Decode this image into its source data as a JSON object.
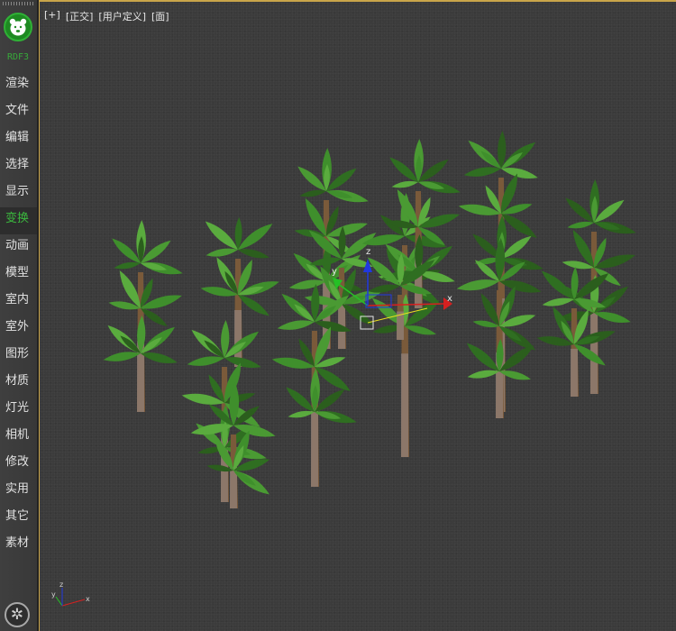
{
  "app": {
    "version_label": "RDF3"
  },
  "sidebar": {
    "items": [
      {
        "label": "渲染",
        "active": false
      },
      {
        "label": "文件",
        "active": false
      },
      {
        "label": "编辑",
        "active": false
      },
      {
        "label": "选择",
        "active": false
      },
      {
        "label": "显示",
        "active": false
      },
      {
        "label": "变换",
        "active": true
      },
      {
        "label": "动画",
        "active": false
      },
      {
        "label": "模型",
        "active": false
      },
      {
        "label": "室内",
        "active": false
      },
      {
        "label": "室外",
        "active": false
      },
      {
        "label": "图形",
        "active": false
      },
      {
        "label": "材质",
        "active": false
      },
      {
        "label": "灯光",
        "active": false
      },
      {
        "label": "相机",
        "active": false
      },
      {
        "label": "修改",
        "active": false
      },
      {
        "label": "实用",
        "active": false
      },
      {
        "label": "其它",
        "active": false
      },
      {
        "label": "素材",
        "active": false
      }
    ],
    "settings_icon": "gear-icon"
  },
  "viewport": {
    "labels": [
      "[+]",
      "[正交]",
      "[用户定义]",
      "[面]"
    ],
    "gizmo": {
      "x_label": "x",
      "y_label": "y",
      "z_label": "z"
    },
    "axis_triad": {
      "x_label": "x",
      "y_label": "y",
      "z_label": "z"
    },
    "colors": {
      "x_axis": "#d62020",
      "y_axis": "#25c025",
      "z_axis": "#2038e0",
      "selection_line": "#e8e020",
      "foliage": "#3f8f2c",
      "trunk": "#7a5a3a",
      "frame": "#c9a54a"
    }
  }
}
